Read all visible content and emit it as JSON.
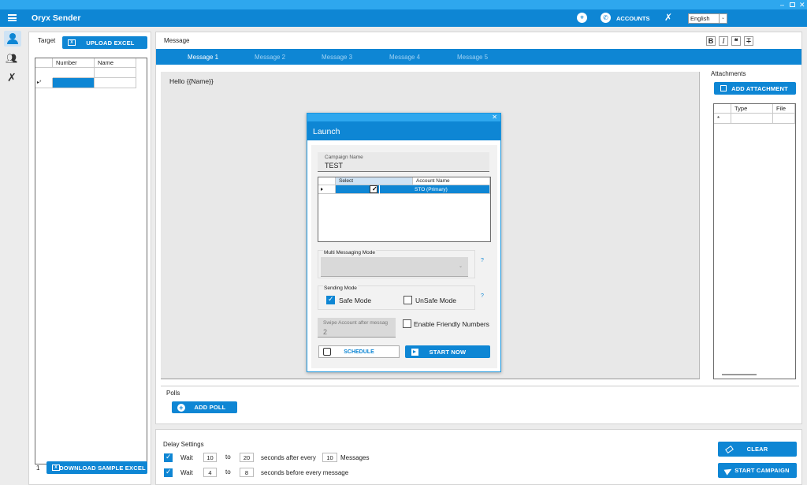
{
  "app": {
    "title": "Oryx Sender"
  },
  "header": {
    "accounts_label": "ACCOUNTS",
    "language": "English"
  },
  "target": {
    "label": "Target",
    "upload_label": "UPLOAD EXCEL",
    "columns": [
      "Number",
      "Name"
    ],
    "row_marker": "▸*",
    "page": "1",
    "download_label": "DOWNLOAD SAMPLE EXCEL"
  },
  "message": {
    "label": "Message",
    "tabs": [
      "Message 1",
      "Message 2",
      "Message 3",
      "Message 4",
      "Message 5"
    ],
    "body": "Hello {{Name}}",
    "format": {
      "bold": "B",
      "italic": "I",
      "quote": "❝",
      "strike": "T"
    }
  },
  "launch": {
    "title": "Launch",
    "campaign_label": "Campaign Name",
    "campaign_value": "TEST",
    "columns": [
      "Select",
      "Account Name"
    ],
    "account_row": "STO (Primary)",
    "multi_mode_label": "Multi Messaging Mode",
    "sending_mode_label": "Sending Mode",
    "safe_mode": "Safe Mode",
    "unsafe_mode": "UnSafe Mode",
    "swipe_label": "Swipe Account after messag",
    "swipe_value": "2",
    "friendly_label": "Enable Friendly Numbers",
    "schedule_label": "SCHEDULE",
    "start_now_label": "START NOW",
    "help": "?"
  },
  "attachments": {
    "label": "Attachments",
    "add_label": "ADD ATTACHMENT",
    "columns": [
      "Type",
      "File"
    ],
    "row_marker": "*"
  },
  "polls": {
    "label": "Polls",
    "add_label": "ADD POLL"
  },
  "delay": {
    "label": "Delay Settings",
    "wait": "Wait",
    "to": "to",
    "row1": {
      "from": "10",
      "to": "20",
      "suffix": "seconds after every",
      "count": "10",
      "unit": "Messages"
    },
    "row2": {
      "from": "4",
      "to": "8",
      "suffix": "seconds before every message"
    }
  },
  "actions": {
    "clear_label": "CLEAR",
    "start_label": "START CAMPAIGN"
  }
}
